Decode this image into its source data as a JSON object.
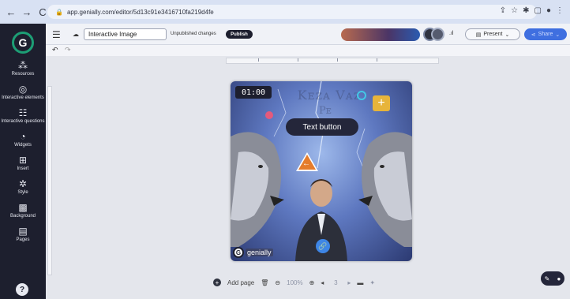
{
  "browser": {
    "url": "app.genially.com/editor/5d13c91e3416710fa219d4fe"
  },
  "sidebar": {
    "items": [
      {
        "label": "Resources",
        "icon": "resources-icon",
        "glyph": "⁂"
      },
      {
        "label": "Interactive elements",
        "icon": "interactive-elements-icon",
        "glyph": "◎"
      },
      {
        "label": "Interactive questions",
        "icon": "interactive-questions-icon",
        "glyph": "☷"
      },
      {
        "label": "Widgets",
        "icon": "widgets-icon",
        "glyph": "◔"
      },
      {
        "label": "Insert",
        "icon": "insert-icon",
        "glyph": "⊞"
      },
      {
        "label": "Style",
        "icon": "style-icon",
        "glyph": "✲"
      },
      {
        "label": "Background",
        "icon": "background-icon",
        "glyph": "▩"
      },
      {
        "label": "Pages",
        "icon": "pages-icon",
        "glyph": "▤"
      }
    ],
    "help": "?"
  },
  "toolbar": {
    "title": "Interactive Image",
    "unsaved": "Unpublished changes",
    "publish": "Publish",
    "present": "Present",
    "share": "Share"
  },
  "slide": {
    "timer": "01:00",
    "text_button": "Text button",
    "title_line1": "Kᴇᴢᴀ Vᴀᴢ",
    "title_line2": "Pᴇ",
    "badge": "genially"
  },
  "bottom": {
    "add_page": "Add page",
    "zoom": "100%",
    "page": "3"
  },
  "colors": {
    "accent": "#3f6fe0",
    "dark": "#1d1f2e",
    "orange": "#e57c2c",
    "yellow": "#e7b43a"
  }
}
